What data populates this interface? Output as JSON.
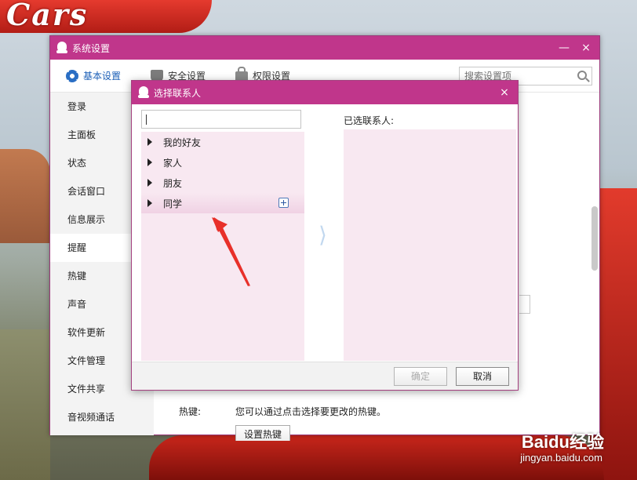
{
  "wallpaper": {
    "logo_text": "Cars"
  },
  "watermark": {
    "brand": "Baidu经验",
    "url": "jingyan.baidu.com"
  },
  "settings_window": {
    "title": "系统设置",
    "minimize": "—",
    "close": "×",
    "toolbar": {
      "basic": "基本设置",
      "security": "安全设置",
      "permission": "权限设置",
      "search_placeholder": "搜索设置项"
    },
    "sidebar": [
      "登录",
      "主面板",
      "状态",
      "会话窗口",
      "信息展示",
      "提醒",
      "热键",
      "声音",
      "软件更新",
      "文件管理",
      "文件共享",
      "音视频通话"
    ],
    "active_sidebar_index": 5,
    "hotkey": {
      "label": "热键:",
      "description": "您可以通过点击选择要更改的热键。",
      "button": "设置热键"
    }
  },
  "dialog": {
    "title": "选择联系人",
    "close": "×",
    "search_value": "",
    "groups": [
      "我的好友",
      "家人",
      "朋友",
      "同学"
    ],
    "hovered_group_index": 3,
    "arrow_glyph": "⟩",
    "selected_label": "已选联系人:",
    "ok_button": "确定",
    "cancel_button": "取消"
  },
  "colors": {
    "titlebar": "#c0368b",
    "accent_blue": "#1b5fb7",
    "tree_bg": "#f8e8f1",
    "annotation_arrow": "#e8302a"
  }
}
